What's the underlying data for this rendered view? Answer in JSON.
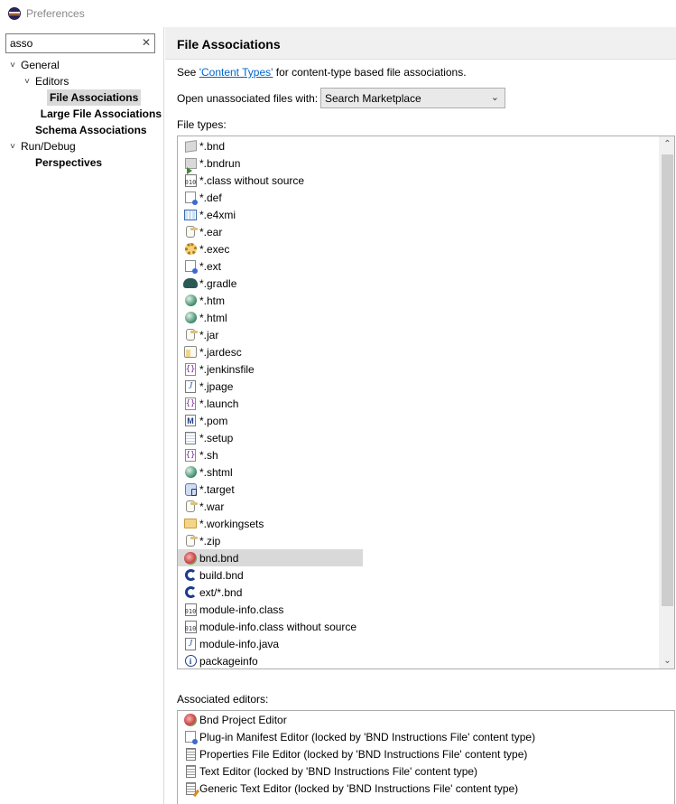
{
  "window": {
    "title": "Preferences"
  },
  "filter": {
    "value": "asso",
    "clear_icon": "✕"
  },
  "tree": [
    {
      "label": "General",
      "level": 0,
      "expanded": true,
      "bold": false,
      "selected": false
    },
    {
      "label": "Editors",
      "level": 1,
      "expanded": true,
      "bold": false,
      "selected": false
    },
    {
      "label": "File Associations",
      "level": 2,
      "expanded": null,
      "bold": true,
      "selected": true
    },
    {
      "label": "Large File Associations",
      "level": 2,
      "expanded": null,
      "bold": true,
      "selected": false
    },
    {
      "label": "Schema Associations",
      "level": 1,
      "expanded": null,
      "bold": true,
      "selected": false
    },
    {
      "label": "Run/Debug",
      "level": 0,
      "expanded": true,
      "bold": false,
      "selected": false
    },
    {
      "label": "Perspectives",
      "level": 1,
      "expanded": null,
      "bold": true,
      "selected": false
    }
  ],
  "page": {
    "title": "File Associations",
    "see_prefix": "See ",
    "see_link": "'Content Types'",
    "see_suffix": " for content-type based file associations.",
    "open_label": "Open unassociated files with:",
    "open_value": "Search Marketplace",
    "file_types_label": "File types:",
    "associated_label": "Associated editors:"
  },
  "file_types": [
    {
      "label": "*.bnd",
      "icon": "cube-icon"
    },
    {
      "label": "*.bndrun",
      "icon": "bndrun-icon"
    },
    {
      "label": "*.class without source",
      "icon": "class-file-icon"
    },
    {
      "label": "*.def",
      "icon": "plugin-def-icon"
    },
    {
      "label": "*.e4xmi",
      "icon": "e4xmi-grid-icon"
    },
    {
      "label": "*.ear",
      "icon": "jar-icon"
    },
    {
      "label": "*.exec",
      "icon": "gear-icon"
    },
    {
      "label": "*.ext",
      "icon": "plugin-ext-icon"
    },
    {
      "label": "*.gradle",
      "icon": "gradle-elephant-icon"
    },
    {
      "label": "*.htm",
      "icon": "globe-icon"
    },
    {
      "label": "*.html",
      "icon": "globe-icon"
    },
    {
      "label": "*.jar",
      "icon": "jar-icon"
    },
    {
      "label": "*.jardesc",
      "icon": "jardesc-icon"
    },
    {
      "label": "*.jenkinsfile",
      "icon": "braces-icon"
    },
    {
      "label": "*.jpage",
      "icon": "java-file-icon"
    },
    {
      "label": "*.launch",
      "icon": "braces-icon"
    },
    {
      "label": "*.pom",
      "icon": "maven-icon"
    },
    {
      "label": "*.setup",
      "icon": "setup-icon"
    },
    {
      "label": "*.sh",
      "icon": "braces-icon"
    },
    {
      "label": "*.shtml",
      "icon": "globe-icon"
    },
    {
      "label": "*.target",
      "icon": "target-icon"
    },
    {
      "label": "*.war",
      "icon": "jar-icon"
    },
    {
      "label": "*.workingsets",
      "icon": "folder-icon"
    },
    {
      "label": "*.zip",
      "icon": "jar-icon"
    },
    {
      "label": "bnd.bnd",
      "icon": "bnd-icon",
      "selected": true
    },
    {
      "label": "build.bnd",
      "icon": "swirl-icon"
    },
    {
      "label": "ext/*.bnd",
      "icon": "swirl-icon"
    },
    {
      "label": "module-info.class",
      "icon": "class-file-icon"
    },
    {
      "label": "module-info.class without source",
      "icon": "class-file-icon"
    },
    {
      "label": "module-info.java",
      "icon": "java-file-icon"
    },
    {
      "label": "packageinfo",
      "icon": "info-icon"
    }
  ],
  "associated_editors": [
    {
      "label": "Bnd Project Editor",
      "icon": "bnd-icon"
    },
    {
      "label": "Plug-in Manifest Editor (locked by 'BND Instructions File' content type)",
      "icon": "plugin-def-icon"
    },
    {
      "label": "Properties File Editor (locked by 'BND Instructions File' content type)",
      "icon": "text-icon"
    },
    {
      "label": "Text Editor (locked by 'BND Instructions File' content type)",
      "icon": "text-icon"
    },
    {
      "label": "Generic Text Editor (locked by 'BND Instructions File' content type)",
      "icon": "text-pen-icon"
    }
  ],
  "colors": {
    "link": "#0066cc",
    "selection": "#d9d9d9",
    "panel": "#f0f0f0"
  }
}
